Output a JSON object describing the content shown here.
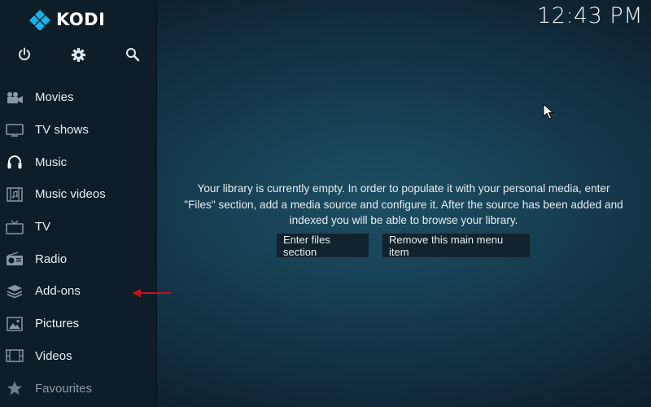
{
  "app": {
    "name": "KODI"
  },
  "clock": {
    "time": "12:43 PM"
  },
  "top_icons": [
    {
      "name": "power-icon"
    },
    {
      "name": "settings-icon"
    },
    {
      "name": "search-icon"
    }
  ],
  "nav": {
    "items": [
      {
        "label": "Movies",
        "icon": "movies-icon"
      },
      {
        "label": "TV shows",
        "icon": "tv-shows-icon"
      },
      {
        "label": "Music",
        "icon": "headphones-icon"
      },
      {
        "label": "Music videos",
        "icon": "music-videos-icon"
      },
      {
        "label": "TV",
        "icon": "tv-icon"
      },
      {
        "label": "Radio",
        "icon": "radio-icon"
      },
      {
        "label": "Add-ons",
        "icon": "addons-icon"
      },
      {
        "label": "Pictures",
        "icon": "pictures-icon"
      },
      {
        "label": "Videos",
        "icon": "videos-icon"
      },
      {
        "label": "Favourites",
        "icon": "star-icon"
      }
    ]
  },
  "main": {
    "message_line1": "Your library is currently empty. In order to populate it with your personal media, enter",
    "message_line2": "\"Files\" section, add a media source and configure it. After the source has been added and",
    "message_line3": "indexed you will be able to browse your library.",
    "enter_files_label": "Enter files section",
    "remove_item_label": "Remove this main menu item"
  },
  "colors": {
    "sidebar_bg": "#0e1d27",
    "background": "#173f52",
    "button_bg": "#12232e",
    "accent_logo": "#1aa3dc",
    "annotation_arrow": "#c0151b"
  }
}
